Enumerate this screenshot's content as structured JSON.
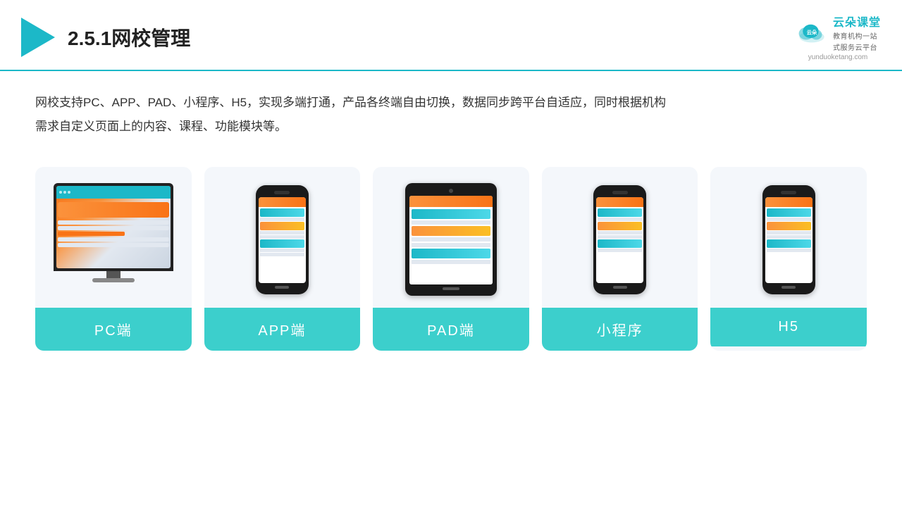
{
  "header": {
    "title": "2.5.1网校管理",
    "brand_name": "云朵课堂",
    "brand_url": "yunduoketang.com",
    "brand_subtitle_1": "教育机构一站",
    "brand_subtitle_2": "式服务云平台"
  },
  "description": {
    "text_line1": "网校支持PC、APP、PAD、小程序、H5，实现多端打通，产品各终端自由切换，数据同步跨平台自适应，同时根据机构",
    "text_line2": "需求自定义页面上的内容、课程、功能模块等。"
  },
  "cards": [
    {
      "label": "PC端",
      "type": "pc"
    },
    {
      "label": "APP端",
      "type": "phone"
    },
    {
      "label": "PAD端",
      "type": "tablet"
    },
    {
      "label": "小程序",
      "type": "phone"
    },
    {
      "label": "H5",
      "type": "phone"
    }
  ]
}
